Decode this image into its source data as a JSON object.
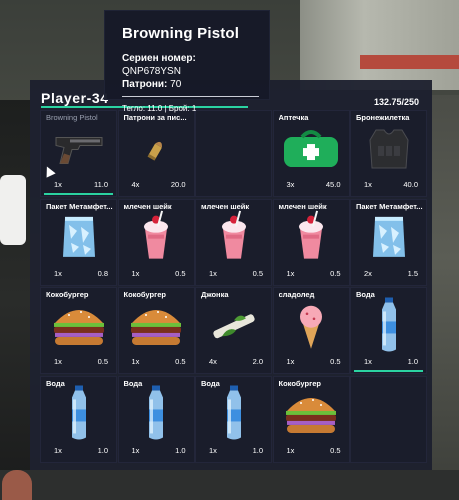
{
  "tooltip": {
    "title": "Browning Pistol",
    "serial_label": "Сериен номер:",
    "serial_value": "QNP678YSN",
    "ammo_label": "Патрони:",
    "ammo_value": "70",
    "footer": "Тегло: 11.0 | Брой: 1"
  },
  "inventory": {
    "player": "Player-34",
    "weight": "132.75/250",
    "accent_color": "#2bd3a1",
    "slots": [
      {
        "name": "Browning Pistol",
        "qty": "1x",
        "weight": "11.0",
        "icon": "pistol-icon",
        "bar": true,
        "dim": true
      },
      {
        "name": "Патрони за пис...",
        "qty": "4x",
        "weight": "20.0",
        "icon": "bullet-icon",
        "bar": false
      },
      {
        "name": "",
        "qty": "",
        "weight": "",
        "icon": "",
        "bar": false
      },
      {
        "name": "Аптечка",
        "qty": "3x",
        "weight": "45.0",
        "icon": "medkit-icon",
        "bar": false
      },
      {
        "name": "Бронежилетка",
        "qty": "1x",
        "weight": "40.0",
        "icon": "vest-icon",
        "bar": false
      },
      {
        "name": "Пакет Метамфет...",
        "qty": "1x",
        "weight": "0.8",
        "icon": "ice-bag-icon",
        "bar": false
      },
      {
        "name": "млечен шейк",
        "qty": "1x",
        "weight": "0.5",
        "icon": "milkshake-icon",
        "bar": false
      },
      {
        "name": "млечен шейк",
        "qty": "1x",
        "weight": "0.5",
        "icon": "milkshake-icon",
        "bar": false
      },
      {
        "name": "млечен шейк",
        "qty": "1x",
        "weight": "0.5",
        "icon": "milkshake-icon",
        "bar": false
      },
      {
        "name": "Пакет Метамфет...",
        "qty": "2x",
        "weight": "1.5",
        "icon": "ice-bag-icon",
        "bar": false
      },
      {
        "name": "Кокобургер",
        "qty": "1x",
        "weight": "0.5",
        "icon": "burger-icon",
        "bar": false
      },
      {
        "name": "Кокобургер",
        "qty": "1x",
        "weight": "0.5",
        "icon": "burger-icon",
        "bar": false
      },
      {
        "name": "Джонка",
        "qty": "4x",
        "weight": "2.0",
        "icon": "joint-icon",
        "bar": false
      },
      {
        "name": "сладолед",
        "qty": "1x",
        "weight": "0.5",
        "icon": "ice-cream-icon",
        "bar": false
      },
      {
        "name": "Вода",
        "qty": "1x",
        "weight": "1.0",
        "icon": "water-bottle-icon",
        "bar": true
      },
      {
        "name": "Вода",
        "qty": "1x",
        "weight": "1.0",
        "icon": "water-bottle-icon",
        "bar": false
      },
      {
        "name": "Вода",
        "qty": "1x",
        "weight": "1.0",
        "icon": "water-bottle-icon",
        "bar": false
      },
      {
        "name": "Вода",
        "qty": "1x",
        "weight": "1.0",
        "icon": "water-bottle-icon",
        "bar": false
      },
      {
        "name": "Кокобургер",
        "qty": "1x",
        "weight": "0.5",
        "icon": "burger-icon",
        "bar": false
      },
      {
        "name": "",
        "qty": "",
        "weight": "",
        "icon": "",
        "bar": false
      }
    ]
  }
}
